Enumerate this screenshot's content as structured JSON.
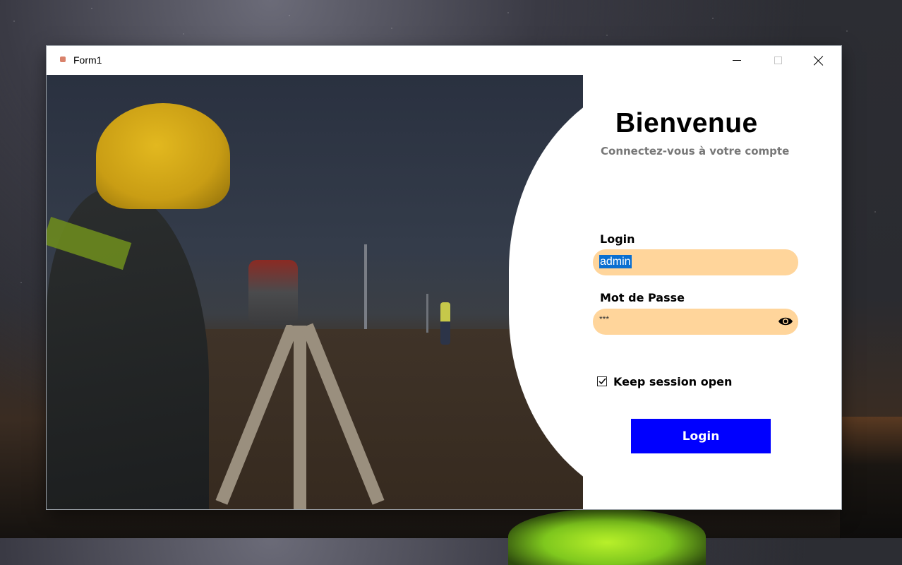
{
  "window": {
    "title": "Form1"
  },
  "login_form": {
    "welcome": "Bienvenue",
    "subtitle": "Connectez-vous à votre compte",
    "login_label": "Login",
    "login_value": "admin",
    "password_label": "Mot de Passe",
    "password_value": "***",
    "keep_session_label": "Keep session open",
    "keep_session_checked": true,
    "submit_label": "Login"
  },
  "icons": {
    "app": "app-icon",
    "minimize": "minimize-icon",
    "maximize": "maximize-icon",
    "close": "close-icon",
    "show_password": "eye-icon",
    "checkbox": "checkmark-icon"
  },
  "colors": {
    "input_background": "#ffd59b",
    "button_background": "#0000ff",
    "selection": "#0a6fd1",
    "subtitle_text": "#777777"
  }
}
